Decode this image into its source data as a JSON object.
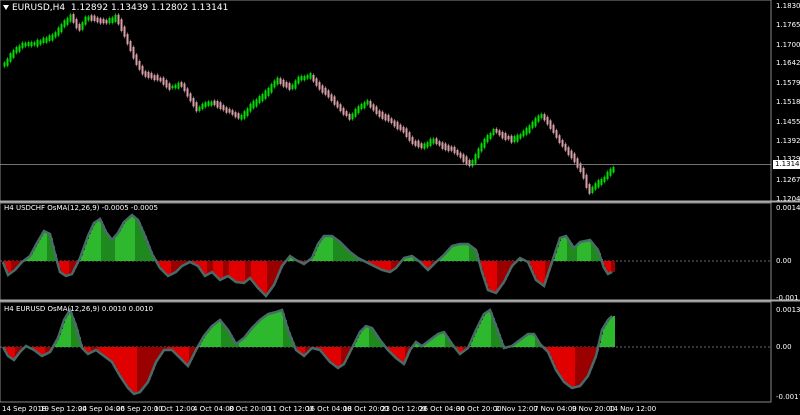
{
  "main": {
    "symbol_label": "EURUSD,H4",
    "ohlc": "1.12892 1.13439 1.12802 1.13141",
    "current_price": "1.13141",
    "price_levels": [
      "1.18300",
      "1.17655",
      "1.17005",
      "1.16425",
      "1.15790",
      "1.15180",
      "1.14550",
      "1.13920",
      "1.13290",
      "1.12675",
      "1.12045"
    ]
  },
  "osma1": {
    "title": "H4 USDCHF OsMA(12,26,9) -0.0005 -0.0005",
    "levels": [
      "0.0014",
      "0.00",
      "-0.001"
    ]
  },
  "osma2": {
    "title": "H4 EURUSD OsMA(12,26,9) 0.0010 0.0010",
    "levels": [
      "0.0013",
      "0.00",
      "-0.0017"
    ]
  },
  "time_axis": [
    "14 Sep 2018",
    "19 Sep 12:00",
    "24 Sep 04:00",
    "26 Sep 20:00",
    "1 Oct 12:00",
    "4 Oct 04:00",
    "8 Oct 20:00",
    "11 Oct 12:00",
    "16 Oct 04:00",
    "18 Oct 20:00",
    "23 Oct 12:00",
    "26 Oct 04:00",
    "30 Oct 20:00",
    "2 Nov 12:00",
    "7 Nov 04:00",
    "9 Nov 20:00",
    "14 Nov 12:00"
  ],
  "colors": {
    "background": "#000000",
    "bull_candle": "#00e000",
    "bear_candle": "#d8a0a8",
    "histogram_up": "#2db82d",
    "histogram_down": "#e00000",
    "signal_line": "#4a6a6a"
  }
}
